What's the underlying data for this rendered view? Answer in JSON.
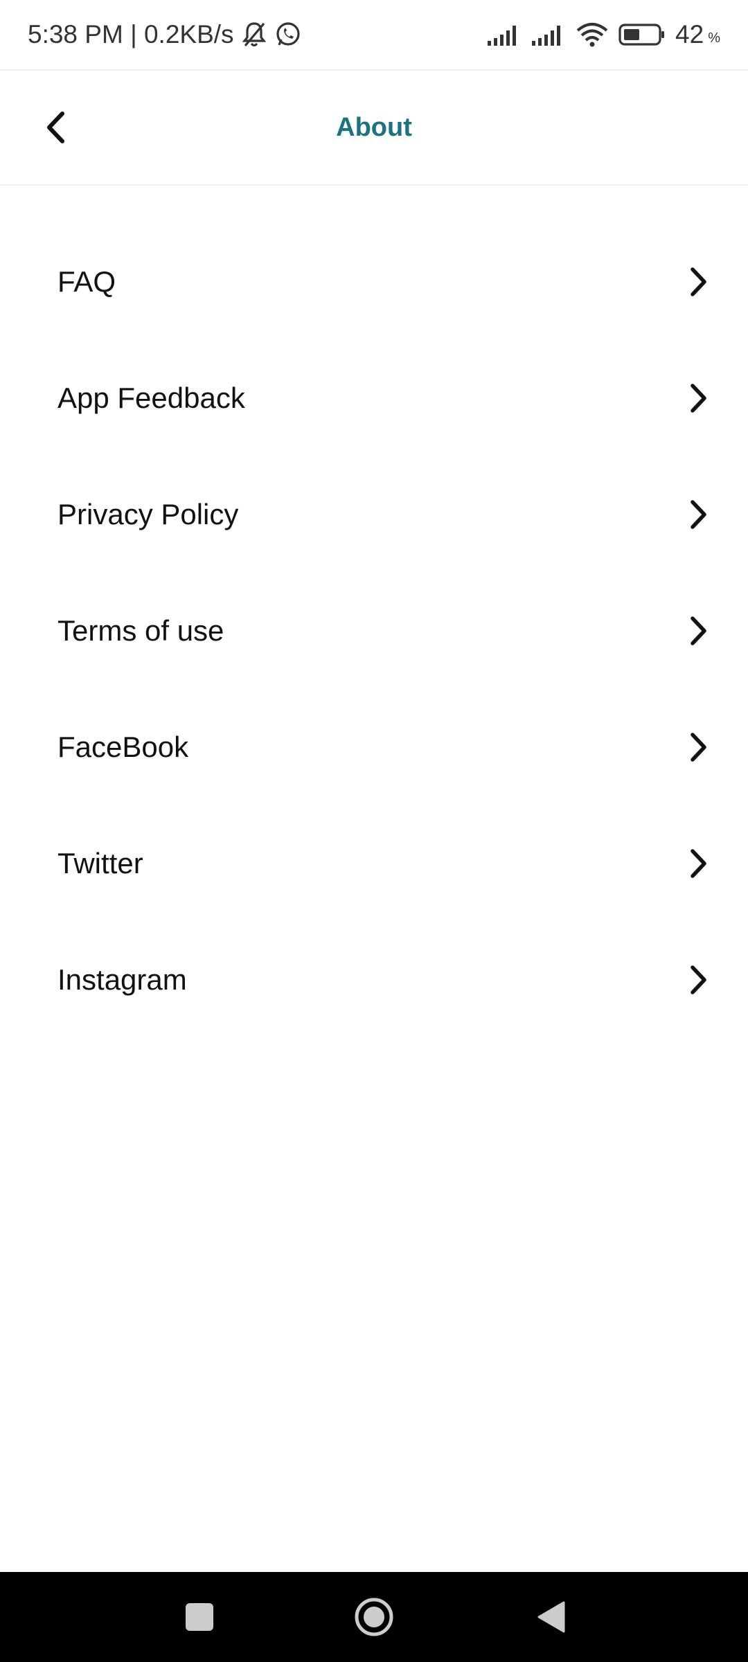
{
  "status_bar": {
    "time_speed": "5:38 PM | 0.2KB/s",
    "battery_value": "42",
    "battery_unit": "%",
    "icons": [
      "mute-bell-icon",
      "whatsapp-icon",
      "signal-icon",
      "signal-icon",
      "wifi-icon",
      "battery-icon"
    ]
  },
  "header": {
    "title": "About",
    "back_icon": "chevron-left-icon",
    "accent_color": "#1b7380"
  },
  "menu": {
    "items": [
      {
        "label": "FAQ"
      },
      {
        "label": "App Feedback"
      },
      {
        "label": "Privacy Policy"
      },
      {
        "label": "Terms of use"
      },
      {
        "label": "FaceBook"
      },
      {
        "label": "Twitter"
      },
      {
        "label": "Instagram"
      }
    ],
    "item_icon": "chevron-right-icon"
  },
  "nav_bar": {
    "icons": [
      "recents-square-icon",
      "home-circle-icon",
      "back-triangle-icon"
    ]
  }
}
